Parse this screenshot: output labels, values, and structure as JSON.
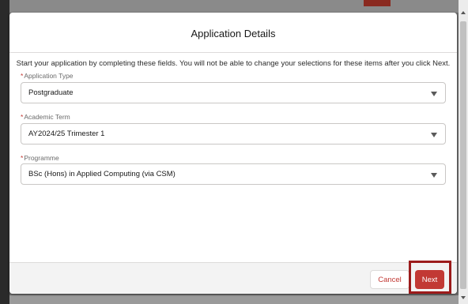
{
  "modal": {
    "title": "Application Details",
    "intro": "Start your application by completing these fields. You will not be able to change your selections for these items after you click Next."
  },
  "fields": {
    "application_type": {
      "required_mark": "*",
      "label": "Application Type",
      "value": "Postgraduate"
    },
    "academic_term": {
      "required_mark": "*",
      "label": "Academic Term",
      "value": "AY2024/25 Trimester 1"
    },
    "programme": {
      "required_mark": "*",
      "label": "Programme",
      "value": "BSc (Hons) in Applied Computing (via CSM)"
    }
  },
  "footer": {
    "cancel_label": "Cancel",
    "next_label": "Next"
  },
  "icons": {
    "caret": "chevron-down-icon",
    "scroll_up": "arrow-up-icon",
    "scroll_down": "arrow-down-icon"
  },
  "colors": {
    "brand_red": "#c23934",
    "highlight_red": "#9c1b1b"
  }
}
